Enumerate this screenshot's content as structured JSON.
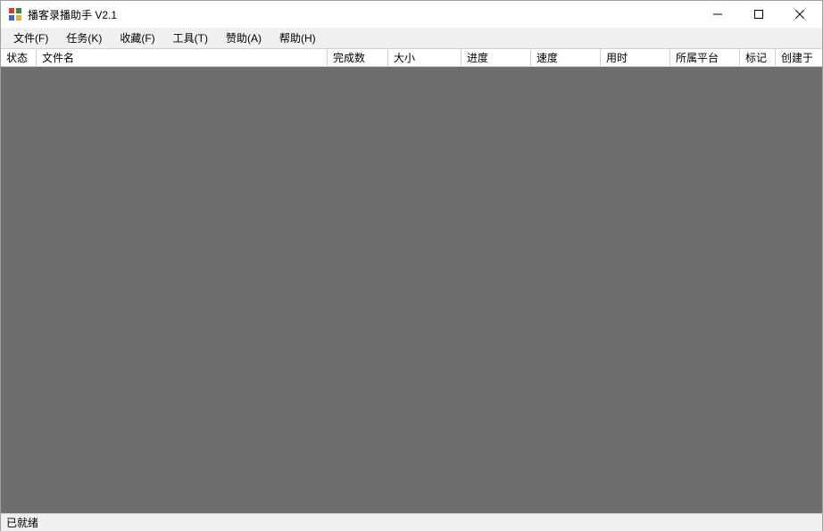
{
  "window": {
    "title": "播客录播助手 V2.1"
  },
  "menu": {
    "file": "文件(F)",
    "task": "任务(K)",
    "favorite": "收藏(F)",
    "tool": "工具(T)",
    "sponsor": "赞助(A)",
    "help": "帮助(H)"
  },
  "columns": {
    "status": "状态",
    "filename": "文件名",
    "completed": "完成数",
    "size": "大小",
    "progress": "进度",
    "speed": "速度",
    "elapsed": "用时",
    "platform": "所属平台",
    "mark": "标记",
    "created": "创建于"
  },
  "rows": [],
  "statusbar": {
    "text": "已就绪"
  }
}
